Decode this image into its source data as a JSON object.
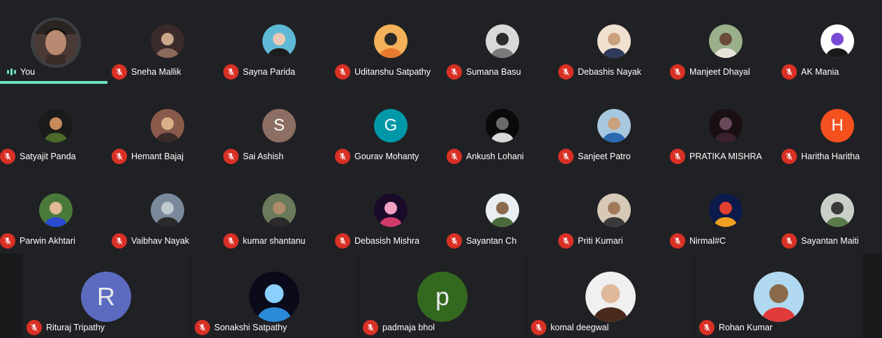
{
  "self": {
    "label": "You"
  },
  "grid": [
    {
      "name": "Sneha Mallik",
      "avatar": {
        "kind": "photo",
        "colors": [
          "#3a2a2a",
          "#8a6a5a",
          "#c9a58a"
        ]
      }
    },
    {
      "name": "Sayna Parida",
      "avatar": {
        "kind": "photo",
        "colors": [
          "#5fb9d6",
          "#1c1c1c",
          "#e9c9b4"
        ]
      }
    },
    {
      "name": "Uditanshu Satpathy",
      "avatar": {
        "kind": "photo",
        "colors": [
          "#f4b15a",
          "#e57a2f",
          "#2a2a2a"
        ]
      }
    },
    {
      "name": "Sumana Basu",
      "avatar": {
        "kind": "photo",
        "colors": [
          "#d9d9d9",
          "#7a7a7a",
          "#2b2b2b"
        ]
      }
    },
    {
      "name": "Debashis Nayak",
      "avatar": {
        "kind": "photo",
        "colors": [
          "#f0e0d0",
          "#2d3a5a",
          "#caa07d"
        ]
      }
    },
    {
      "name": "Manjeet Dhayal",
      "avatar": {
        "kind": "photo",
        "colors": [
          "#9ab08a",
          "#e8e2d8",
          "#6b4a3a"
        ]
      }
    },
    {
      "name": "AK Mania",
      "avatar": {
        "kind": "photo",
        "colors": [
          "#ffffff",
          "#1a1a1a",
          "#7a4ad6"
        ]
      }
    },
    {
      "name": "Satyajit Panda",
      "avatar": {
        "kind": "photo",
        "colors": [
          "#1a1a1a",
          "#4a6a2a",
          "#c98a5a"
        ]
      }
    },
    {
      "name": "Hemant Bajaj",
      "avatar": {
        "kind": "photo",
        "colors": [
          "#8a5a4a",
          "#3a2a2a",
          "#d9b08a"
        ]
      }
    },
    {
      "name": "Sai Ashish",
      "avatar": {
        "kind": "letter",
        "letter": "S",
        "bg": "#8d6e63"
      }
    },
    {
      "name": "Gourav Mohanty",
      "avatar": {
        "kind": "letter",
        "letter": "G",
        "bg": "#0097a7"
      }
    },
    {
      "name": "Ankush Lohani",
      "avatar": {
        "kind": "photo",
        "colors": [
          "#0a0a0a",
          "#d9d9d9",
          "#6a6a6a"
        ]
      }
    },
    {
      "name": "Sanjeet Patro",
      "avatar": {
        "kind": "photo",
        "colors": [
          "#a8c8e0",
          "#2a6ab0",
          "#caa07d"
        ]
      }
    },
    {
      "name": "PRATIKA MISHRA",
      "avatar": {
        "kind": "photo",
        "colors": [
          "#1a1014",
          "#3a2030",
          "#6a4a5a"
        ]
      }
    },
    {
      "name": "Haritha Haritha",
      "avatar": {
        "kind": "letter",
        "letter": "H",
        "bg": "#f4511e"
      }
    },
    {
      "name": "Parwin Akhtari",
      "avatar": {
        "kind": "photo",
        "colors": [
          "#4a7a3a",
          "#2a4ad0",
          "#e0b89a"
        ]
      }
    },
    {
      "name": "Vaibhav Nayak",
      "avatar": {
        "kind": "photo",
        "colors": [
          "#7a8a9a",
          "#2a2a2a",
          "#c0c8d0"
        ]
      }
    },
    {
      "name": "kumar shantanu",
      "avatar": {
        "kind": "photo",
        "colors": [
          "#6a7a5a",
          "#2a2a2a",
          "#b08a6a"
        ]
      }
    },
    {
      "name": "Debasish Mishra",
      "avatar": {
        "kind": "photo",
        "colors": [
          "#1a0a2a",
          "#d03a6a",
          "#f0a0c0"
        ]
      }
    },
    {
      "name": "Sayantan Ch",
      "avatar": {
        "kind": "photo",
        "colors": [
          "#e8eef2",
          "#4a6a3a",
          "#8a6a4a"
        ]
      }
    },
    {
      "name": "Priti Kumari",
      "avatar": {
        "kind": "photo",
        "colors": [
          "#d8c8b8",
          "#3a3a3a",
          "#a07a5a"
        ]
      }
    },
    {
      "name": "Nirmal#C",
      "avatar": {
        "kind": "photo",
        "colors": [
          "#0a1a4a",
          "#f0a020",
          "#e04030"
        ]
      }
    },
    {
      "name": "Sayantan Maiti",
      "avatar": {
        "kind": "photo",
        "colors": [
          "#c8d0c8",
          "#5a7a4a",
          "#3a3a3a"
        ]
      }
    }
  ],
  "bottom_row": [
    {
      "name": "Rituraj Tripathy",
      "avatar": {
        "kind": "letter",
        "letter": "R",
        "bg": "#5c6bc0"
      }
    },
    {
      "name": "Sonakshi Satpathy",
      "avatar": {
        "kind": "photo",
        "colors": [
          "#0a0a1a",
          "#2a8ad8",
          "#8ad0ff"
        ]
      }
    },
    {
      "name": "padmaja bhol",
      "avatar": {
        "kind": "letter",
        "letter": "p",
        "bg": "#33691e"
      }
    },
    {
      "name": "komal deegwal",
      "avatar": {
        "kind": "photo",
        "colors": [
          "#f0f0f0",
          "#4a2a1a",
          "#e0b89a"
        ]
      }
    },
    {
      "name": "Rohan Kumar",
      "avatar": {
        "kind": "photo",
        "colors": [
          "#b0d8f0",
          "#e03a3a",
          "#8a6a4a"
        ]
      }
    }
  ],
  "colors": {
    "mute_red": "#d93025",
    "speaking_teal": "#6de2c3",
    "background": "#202124"
  },
  "icons": {
    "mute": "mic-off-icon",
    "speaking": "audio-level-icon"
  }
}
